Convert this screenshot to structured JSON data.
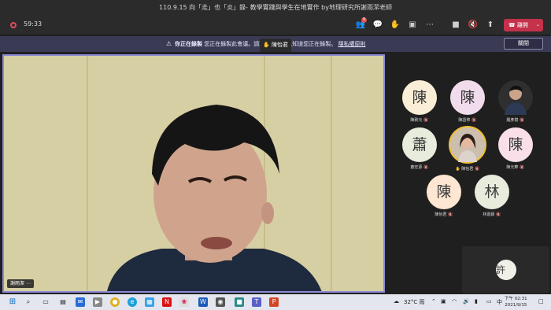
{
  "window": {
    "title": "110.9.15 向「走」也「炎」錄- 教學實踐與學生在地實作 by地理研究所謝雨潔老師"
  },
  "toolbar": {
    "timer": "59:33",
    "participants_badge": "9",
    "hangup_label": "離開",
    "icons": [
      "people-icon",
      "chat-icon",
      "raise-hand-icon",
      "rooms-icon",
      "more-icon",
      "camera-icon",
      "mic-muted-icon",
      "share-icon"
    ]
  },
  "banner": {
    "prefix": "你正在錄製",
    "message": "您正在錄製此會議。請務必讓所有人知道您正在錄製。",
    "link": "隱私權原則",
    "close_label": "關閉"
  },
  "raise_popup": {
    "name": "陳怡君"
  },
  "stage": {
    "speaker_name": "謝雨潔"
  },
  "participants": [
    {
      "initial": "陳",
      "name": "陳致元",
      "color": "#fbeed6"
    },
    {
      "initial": "陳",
      "name": "陳語箏",
      "color": "#f1dcec"
    },
    {
      "initial": "",
      "name": "羅彥樹",
      "color": "#3a3a3a",
      "photo": true
    },
    {
      "initial": "蕭",
      "name": "蕭宏源",
      "color": "#e7ecdc"
    },
    {
      "initial": "",
      "name": "陳怡君",
      "color": "#d9c8b5",
      "photo": true,
      "hand": true
    },
    {
      "initial": "陳",
      "name": "陳元華",
      "color": "#f8dfe8"
    },
    {
      "initial": "陳",
      "name": "陳怡君",
      "color": "#fde6d2"
    },
    {
      "initial": "林",
      "name": "林嘉穎",
      "color": "#e7ecdc"
    }
  ],
  "self": {
    "initial": "許"
  },
  "taskbar": {
    "weather": "32°C 雨",
    "ime": "中",
    "time": "下午 02:31",
    "date": "2021/9/15",
    "accent": "#0067c0"
  }
}
